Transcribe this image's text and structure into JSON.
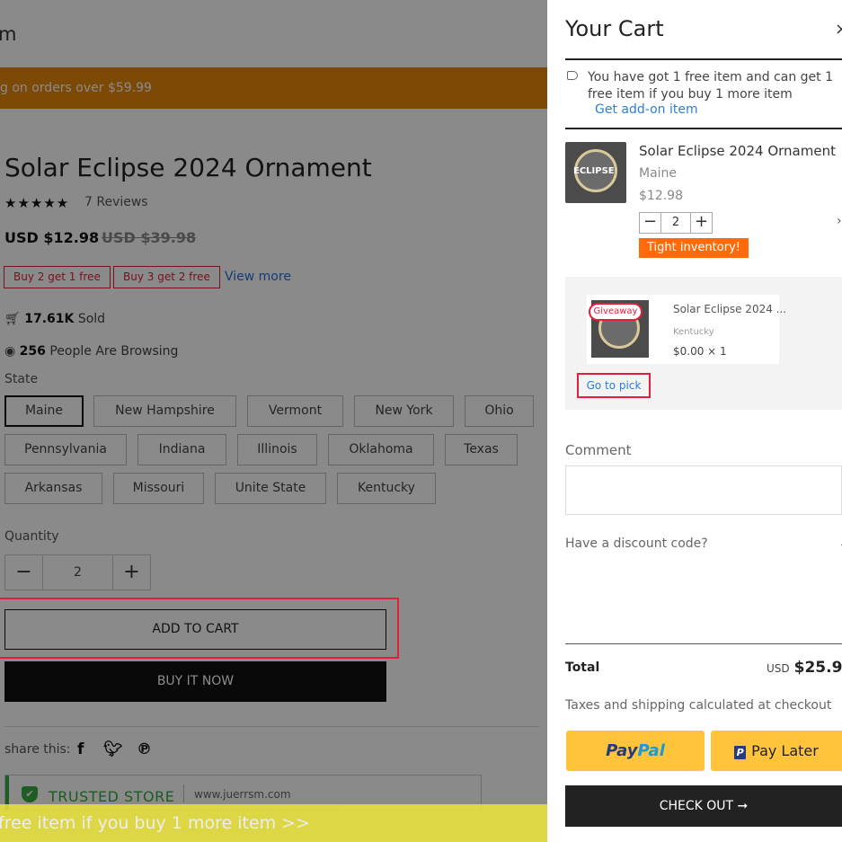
{
  "product_page": {
    "logo_text": "m",
    "banner_text": "g on orders over $59.99",
    "title": "Solar Eclipse 2024 Ornament",
    "stars": "★★★★★",
    "reviews": "7 Reviews",
    "price": "USD $12.98",
    "old_price": "USD $39.98",
    "promos": [
      "Buy 2 get 1 free",
      "Buy 3 get 2 free"
    ],
    "view_more": "View more",
    "sold_count": "17.61K",
    "sold_label": "Sold",
    "browsing_count": "256",
    "browsing_label": "People Are Browsing",
    "state_label": "State",
    "states": [
      "Maine",
      "New Hampshire",
      "Vermont",
      "New York",
      "Ohio",
      "Pennsylvania",
      "Indiana",
      "Illinois",
      "Oklahoma",
      "Texas",
      "Arkansas",
      "Missouri",
      "Unite State",
      "Kentucky"
    ],
    "selected_state": "Maine",
    "quantity_label": "Quantity",
    "quantity": "2",
    "add_to_cart": "ADD TO CART",
    "buy_now": "BUY IT NOW",
    "share_label": "share this:",
    "trusted_store": "TRUSTED STORE",
    "trusted_domain": "www.juerrsm.com",
    "bottom_bar": "free item if you buy 1 more item  >>"
  },
  "cart": {
    "title": "Your Cart",
    "close_icon": "×",
    "free_message": "You have got 1 free item and can get 1 free item if you buy 1 more item",
    "addon_link": "Get add-on item",
    "item": {
      "name": "Solar Eclipse 2024 Ornament",
      "variant": "Maine",
      "price": "$12.98",
      "quantity": "2",
      "stock_badge": "Tight inventory!",
      "image_text": "ECLIPSE"
    },
    "gift": {
      "badge": "Giveaway",
      "name": "Solar Eclipse 2024 ...",
      "variant": "Kentucky",
      "price": "$0.00 × 1",
      "pick_button": "Go to pick"
    },
    "comment_label": "Comment",
    "discount_label": "Have a discount code?",
    "total_label": "Total",
    "total_currency": "USD",
    "total_value": "$25.9",
    "taxes_note": "Taxes and shipping calculated at checkout",
    "paypal_a": "Pay",
    "paypal_b": "Pal",
    "paylater_label": "Pay Later",
    "checkout_label": "CHECK OUT ➞"
  },
  "colors": {
    "banner": "#e8870d",
    "promo_red": "#e0203a",
    "link_blue": "#2a7fd6",
    "inventory_orange": "#ff6b0a",
    "paypal_yellow": "#ffc439",
    "trusted_green": "#3aa845"
  }
}
